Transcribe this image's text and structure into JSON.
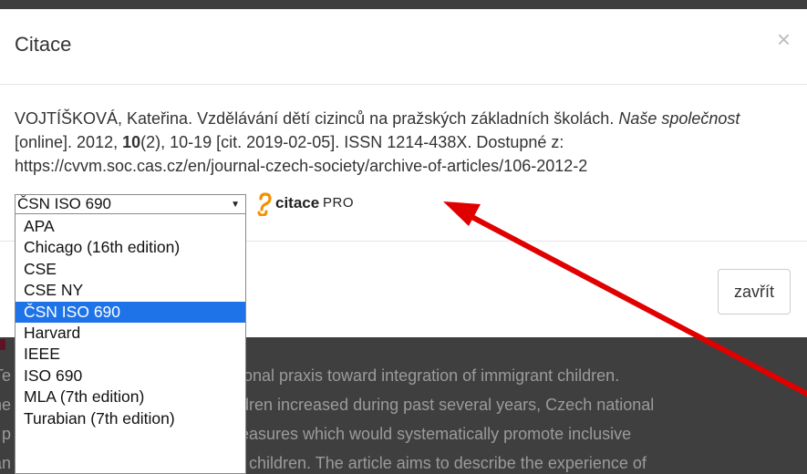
{
  "background": {
    "lines": [
      {
        "pre": "Te",
        "rest": "ional praxis toward integration of immigrant children."
      },
      {
        "pre": "The",
        "rest": "dren increased during past several years, Czech national"
      },
      {
        "pre": "l p",
        "rest": "easures which would systematically promote inclusive"
      },
      {
        "pre": "an",
        "rest": "t children. The article aims to describe the experience of"
      }
    ]
  },
  "modal": {
    "title": "Citace",
    "close_symbol": "×",
    "citation": {
      "author": "VOJTÍŠKOVÁ, Kateřina.",
      "article": " Vzdělávání dětí cizinců na pražských základních školách. ",
      "journal": "Naše společnost",
      "online": " [online]. 2012, ",
      "volume": "10",
      "rest": "(2), 10-19 [cit. 2019-02-05]. ISSN 1214-438X. Dostupné z: https://cvvm.soc.cas.cz/en/journal-czech-society/archive-of-articles/106-2012-2"
    },
    "style_select": {
      "value": "ČSN ISO 690",
      "caret": "▼"
    },
    "brand": {
      "name": "citace",
      "suffix": "PRO",
      "accent_color": "#f29200"
    },
    "footer": {
      "close_label": "zavřít"
    }
  },
  "dropdown": {
    "options": [
      {
        "label": "APA"
      },
      {
        "label": "Chicago (16th edition)"
      },
      {
        "label": "CSE"
      },
      {
        "label": "CSE NY"
      },
      {
        "label": "ČSN ISO 690",
        "selected": true
      },
      {
        "label": "Harvard"
      },
      {
        "label": "IEEE"
      },
      {
        "label": "ISO 690"
      },
      {
        "label": "MLA (7th edition)"
      },
      {
        "label": "Turabian (7th edition)"
      }
    ],
    "selected_color": "#1e73e8"
  },
  "annotation": {
    "arrow_color": "#e00000"
  }
}
